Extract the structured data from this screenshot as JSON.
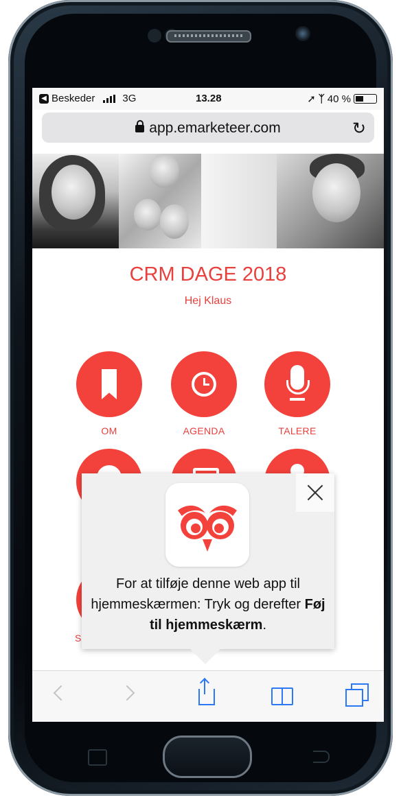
{
  "status_bar": {
    "carrier": "Beskeder",
    "network": "3G",
    "time": "13.28",
    "battery": "40 %",
    "battery_level_percent": 40
  },
  "browser": {
    "url": "app.emarketeer.com"
  },
  "event": {
    "title": "CRM DAGE 2018",
    "greeting": "Hej Klaus"
  },
  "tiles": [
    {
      "label": "OM",
      "icon": "bookmark-icon"
    },
    {
      "label": "AGENDA",
      "icon": "clock-icon"
    },
    {
      "label": "TALERE",
      "icon": "microphone-icon"
    }
  ],
  "partial_tile_label": "S",
  "popup": {
    "text_before": "For at tilføje denne web app til hjemmeskærmen: Tryk  og derefter ",
    "text_bold": "Føj til hjemmeskærm",
    "text_after": "."
  },
  "colors": {
    "accent": "#f2423b",
    "ios_blue": "#2a78f6"
  }
}
